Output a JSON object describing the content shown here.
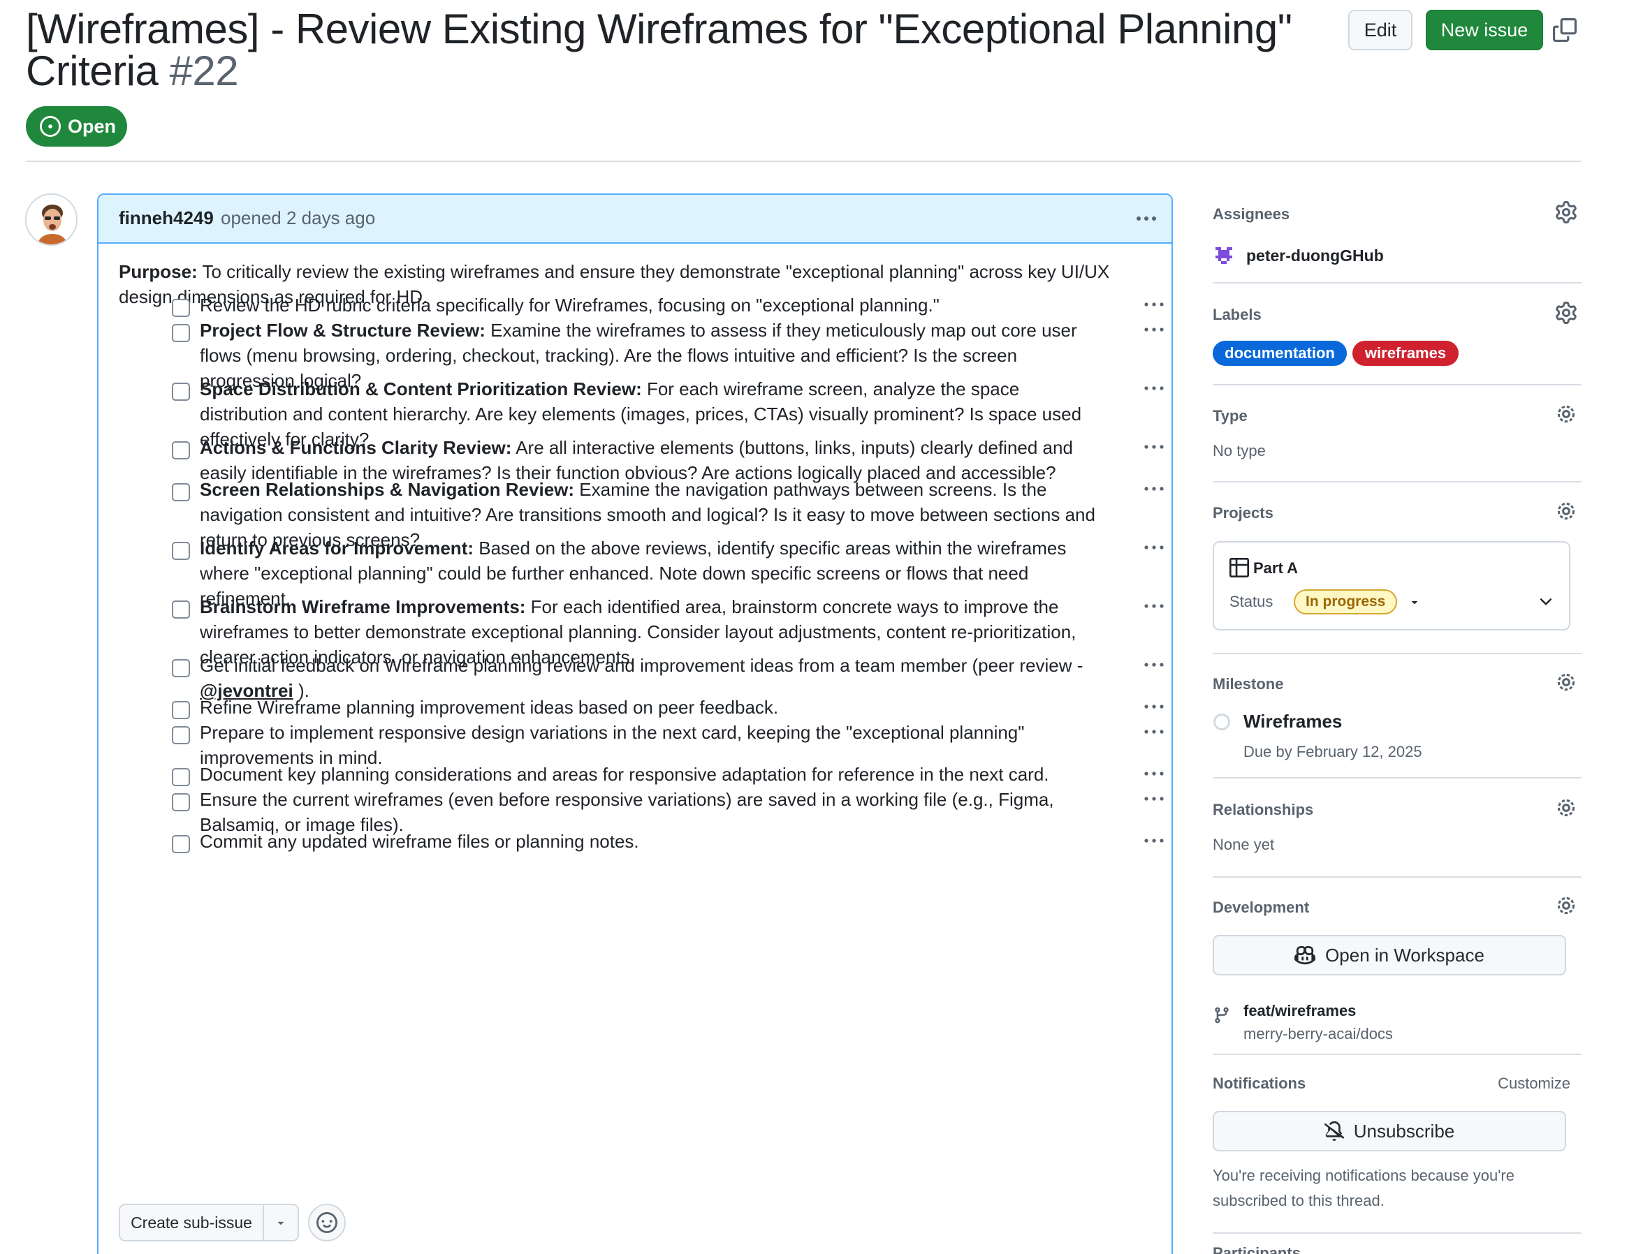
{
  "issue": {
    "title": "[Wireframes] - Review Existing Wireframes for \"Exceptional Planning\" Criteria",
    "number": "#22",
    "state": "Open",
    "edit_label": "Edit",
    "new_issue_label": "New issue"
  },
  "comment": {
    "author": "finneh4249",
    "opened": "opened 2 days ago",
    "purpose_label": "Purpose:",
    "purpose_text": " To critically review the existing wireframes and ensure they demonstrate \"exceptional planning\" across key UI/UX design dimensions as required for HD.",
    "tasks": [
      {
        "bold": "",
        "text": "Review the HD rubric criteria specifically for Wireframes, focusing on \"exceptional planning.\""
      },
      {
        "bold": "Project Flow & Structure Review:",
        "text": " Examine the wireframes to assess if they meticulously map out core user flows (menu browsing, ordering, checkout, tracking). Are the flows intuitive and efficient? Is the screen progression logical?"
      },
      {
        "bold": "Space Distribution & Content Prioritization Review:",
        "text": " For each wireframe screen, analyze the space distribution and content hierarchy. Are key elements (images, prices, CTAs) visually prominent? Is space used effectively for clarity?"
      },
      {
        "bold": "Actions & Functions Clarity Review:",
        "text": " Are all interactive elements (buttons, links, inputs) clearly defined and easily identifiable in the wireframes? Is their function obvious? Are actions logically placed and accessible?"
      },
      {
        "bold": "Screen Relationships & Navigation Review:",
        "text": " Examine the navigation pathways between screens. Is the navigation consistent and intuitive? Are transitions smooth and logical? Is it easy to move between sections and return to previous screens?"
      },
      {
        "bold": "Identify Areas for Improvement:",
        "text": " Based on the above reviews, identify specific areas within the wireframes where \"exceptional planning\" could be further enhanced. Note down specific screens or flows that need refinement."
      },
      {
        "bold": "Brainstorm Wireframe Improvements:",
        "text": " For each identified area, brainstorm concrete ways to improve the wireframes to better demonstrate exceptional planning. Consider layout adjustments, content re-prioritization, clearer action indicators, or navigation enhancements."
      },
      {
        "bold": "",
        "text": "Get initial feedback on Wireframe planning review and improvement ideas from a team member (peer review - ",
        "mention": "@jevontrei",
        "after": " )."
      },
      {
        "bold": "",
        "text": "Refine Wireframe planning improvement ideas based on peer feedback."
      },
      {
        "bold": "",
        "text": "Prepare to implement responsive design variations in the next card, keeping the \"exceptional planning\" improvements in mind."
      },
      {
        "bold": "",
        "text": "Document key planning considerations and areas for responsive adaptation for reference in the next card."
      },
      {
        "bold": "",
        "text": "Ensure the current wireframes (even before responsive variations) are saved in a working file (e.g., Figma, Balsamiq, or image files)."
      },
      {
        "bold": "",
        "text": "Commit any updated wireframe files or planning notes."
      }
    ],
    "create_subissue_label": "Create sub-issue"
  },
  "sidebar": {
    "assignees_title": "Assignees",
    "assignee": "peter-duongGHub",
    "labels_title": "Labels",
    "labels": [
      {
        "name": "documentation",
        "color": "#0969da"
      },
      {
        "name": "wireframes",
        "color": "#cf222e"
      }
    ],
    "type_title": "Type",
    "type_value": "No type",
    "projects_title": "Projects",
    "project_name": "Part A",
    "status_label": "Status",
    "status_value": "In progress",
    "milestone_title": "Milestone",
    "milestone_name": "Wireframes",
    "milestone_due": "Due by February 12, 2025",
    "relationships_title": "Relationships",
    "relationships_value": "None yet",
    "development_title": "Development",
    "workspace_label": "Open in Workspace",
    "branch_name": "feat/wireframes",
    "branch_repo": "merry-berry-acai/docs",
    "notifications_title": "Notifications",
    "customize_label": "Customize",
    "unsubscribe_label": "Unsubscribe",
    "notifications_reason": "You're receiving notifications because you're subscribed to this thread.",
    "participants_title": "Participants"
  },
  "colors": {
    "accent_green": "#1f883d",
    "header_blue": "#ddf4ff",
    "border_blue": "#54aeff",
    "status_yellow": "#fff8c5"
  }
}
